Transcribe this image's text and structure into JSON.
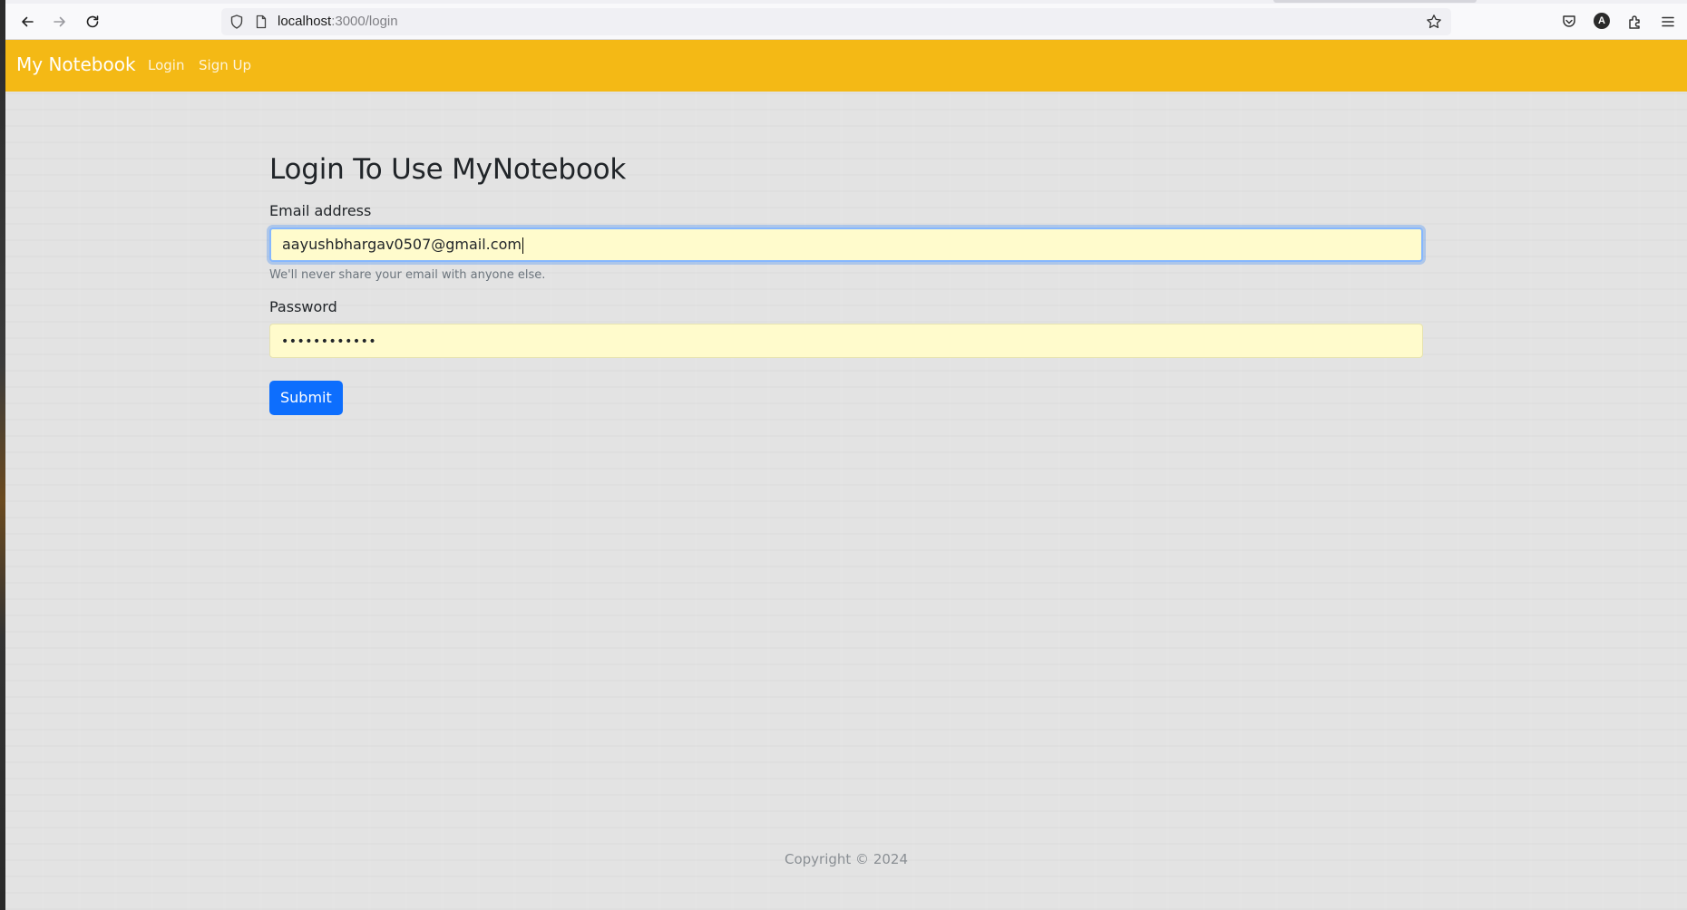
{
  "browser": {
    "url_host": "localhost",
    "url_path": ":3000/login",
    "profile_initial": "A"
  },
  "navbar": {
    "brand": "My Notebook",
    "links": [
      "Login",
      "Sign Up"
    ],
    "background_color": "#f4b915"
  },
  "login_form": {
    "title": "Login To Use MyNotebook",
    "email_label": "Email address",
    "email_value": "aayushbhargav0507@gmail.com",
    "email_help": "We'll never share your email with anyone else.",
    "password_label": "Password",
    "password_masked": "••••••••••••",
    "submit_label": "Submit",
    "submit_color": "#0d6efd",
    "input_autofill_color": "#fffbcc"
  },
  "footer": {
    "text": "Copyright © 2024"
  }
}
